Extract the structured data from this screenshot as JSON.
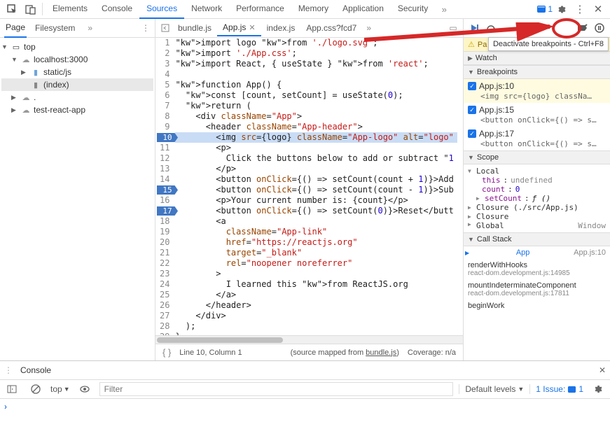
{
  "topbar": {
    "tabs": [
      "Elements",
      "Console",
      "Sources",
      "Network",
      "Performance",
      "Memory",
      "Application",
      "Security"
    ],
    "active_tab": "Sources",
    "issue_count": "1"
  },
  "sidebar": {
    "tabs": {
      "page": "Page",
      "filesystem": "Filesystem"
    },
    "tree": {
      "top": "top",
      "host": "localhost:3000",
      "folder": "static/js",
      "file": "(index)",
      "cloud2": ".",
      "cloud3": "test-react-app"
    }
  },
  "editor": {
    "tabs": {
      "bundle": "bundle.js",
      "app": "App.js",
      "index": "index.js",
      "appcss": "App.css?fcd7"
    },
    "lines": [
      "import logo from './logo.svg';",
      "import './App.css';",
      "import React, { useState } from 'react';",
      "",
      "function App() {",
      "  const [count, setCount] = useState(0);",
      "  return (",
      "    <div className=\"App\">",
      "      <header className=\"App-header\">",
      "        <img src={logo} className=\"App-logo\" alt=\"logo\"",
      "        <p>",
      "          Click the buttons below to add or subtract \"1",
      "        </p>",
      "        <button onClick={() => setCount(count + 1)}>Add",
      "        <button onClick={() => setCount(count - 1)}>Sub",
      "        <p>Your current number is: {count}</p>",
      "        <button onClick={() => setCount(0)}>Reset</butt",
      "        <a",
      "          className=\"App-link\"",
      "          href=\"https://reactjs.org\"",
      "          target=\"_blank\"",
      "          rel=\"noopener noreferrer\"",
      "        >",
      "          I learned this from ReactJS.org",
      "        </a>",
      "      </header>",
      "    </div>",
      "  );",
      "}"
    ],
    "breakpoint_lines": [
      10,
      15,
      17
    ],
    "exec_line": 10,
    "status": {
      "position": "Line 10, Column 1",
      "mapped": "(source mapped from ",
      "bundle": "bundle.js",
      "mapped_end": ")",
      "coverage": "Coverage: n/a"
    }
  },
  "debugger": {
    "tooltip": "Deactivate breakpoints - Ctrl+F8",
    "paused_banner": "Pa",
    "sections": {
      "watch": "Watch",
      "breakpoints": "Breakpoints",
      "scope": "Scope",
      "callstack": "Call Stack"
    },
    "breakpoints": [
      {
        "label": "App.js:10",
        "preview": "<img src={logo} classNa…",
        "active": true
      },
      {
        "label": "App.js:15",
        "preview": "<button onClick={() => s…",
        "active": false
      },
      {
        "label": "App.js:17",
        "preview": "<button onClick={() => s…",
        "active": false
      }
    ],
    "scope": {
      "local": "Local",
      "this_k": "this",
      "this_v": "undefined",
      "count_k": "count",
      "count_v": "0",
      "setcount_k": "setCount",
      "setcount_v": "ƒ ()",
      "closure1": "Closure (./src/App.js)",
      "closure2": "Closure",
      "global_k": "Global",
      "global_v": "Window"
    },
    "stack": [
      {
        "name": "App",
        "loc": "App.js:10",
        "current": true
      },
      {
        "name": "renderWithHooks",
        "loc": "react-dom.development.js:14985",
        "current": false
      },
      {
        "name": "mountIndeterminateComponent",
        "loc": "react-dom.development.js:17811",
        "current": false
      },
      {
        "name": "beginWork",
        "loc": "",
        "current": false
      }
    ]
  },
  "console": {
    "title": "Console",
    "top_context": "top",
    "filter_placeholder": "Filter",
    "levels": "Default levels",
    "issues_label": "1 Issue:",
    "issues_count": "1"
  }
}
